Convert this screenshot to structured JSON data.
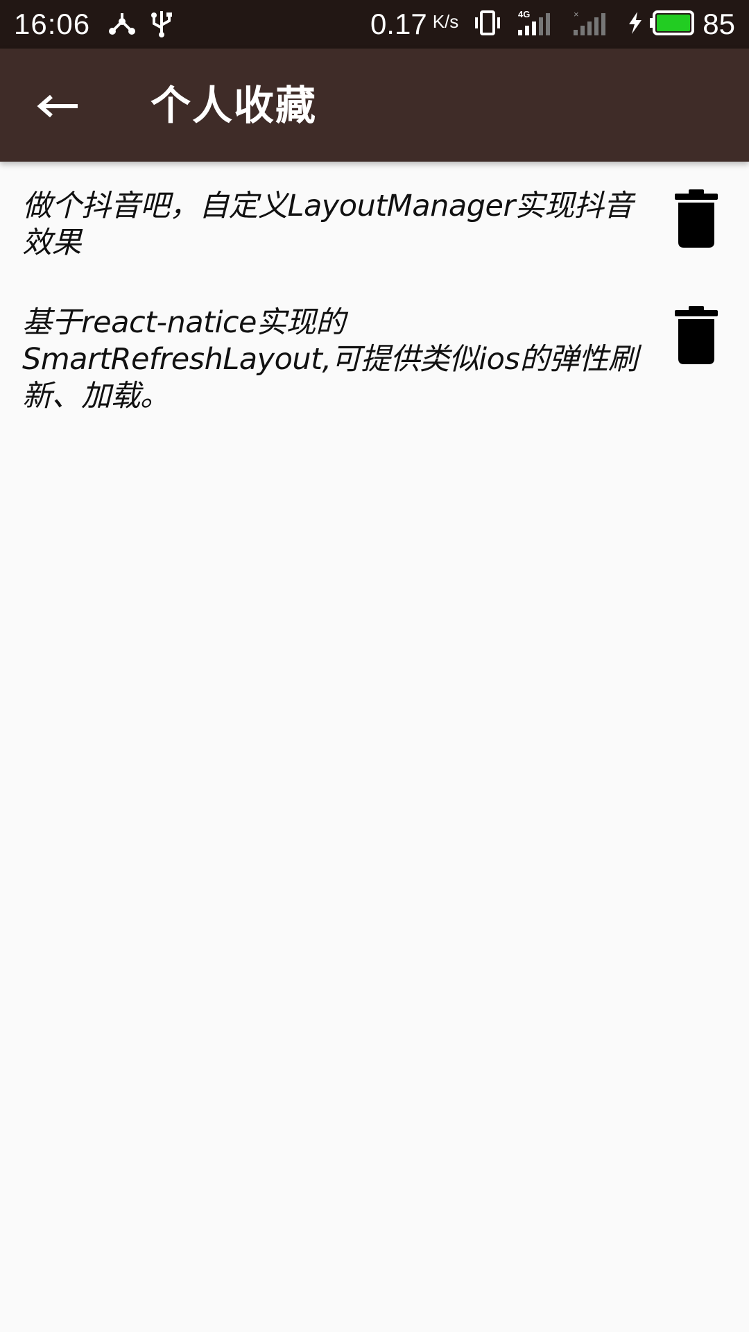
{
  "status_bar": {
    "time": "16:06",
    "net_speed": "0.17",
    "net_speed_unit": "K/s",
    "network_type": "4G",
    "battery_level": "85",
    "battery_color": "#22cc22",
    "icons": [
      "share-icon",
      "usb-icon",
      "vibrate-icon",
      "signal-4g-icon",
      "signal-no-sim-icon",
      "charging-icon",
      "battery-icon"
    ]
  },
  "app_bar": {
    "title": "个人收藏",
    "back_icon": "back-arrow-icon",
    "background": "#3f2c28"
  },
  "favorites": {
    "items": [
      {
        "title": "做个抖音吧，自定义LayoutManager实现抖音效果",
        "action_icon": "trash-icon"
      },
      {
        "title": "基于react-natice实现的SmartRefreshLayout,可提供类似ios的弹性刷新、加载。",
        "action_icon": "trash-icon"
      }
    ]
  }
}
